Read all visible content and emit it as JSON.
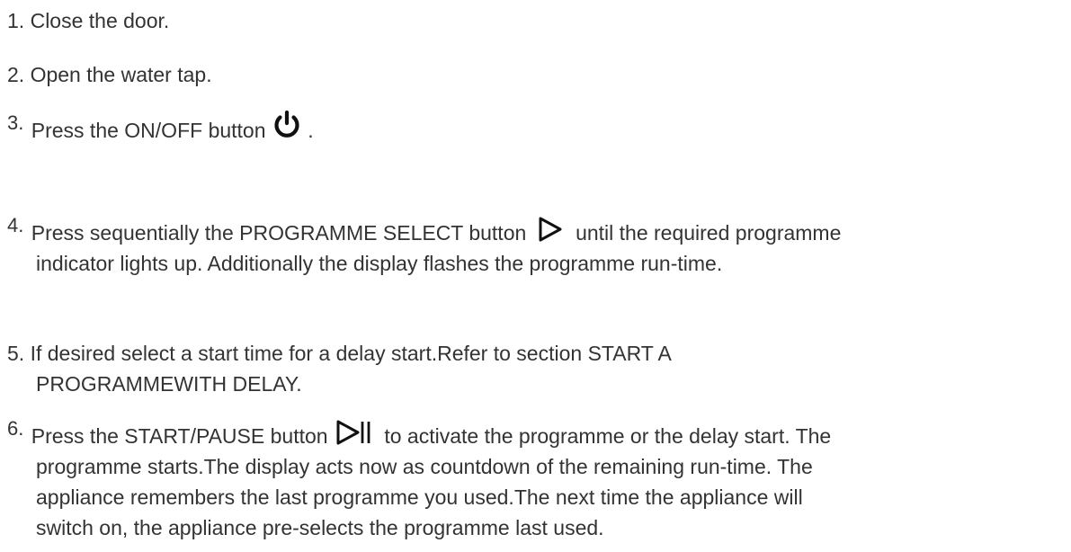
{
  "steps": [
    {
      "number": "1.",
      "text": "Close the door."
    },
    {
      "number": "2.",
      "text": "Open the water tap."
    },
    {
      "number": "3.",
      "before": "Press the ON/OFF button",
      "icon": "power-icon",
      "after": "."
    },
    {
      "number": "4.",
      "before": "Press sequentially the PROGRAMME SELECT button",
      "icon": "play-outline-icon",
      "after": "until the required programme",
      "line2": "indicator lights up. Additionally the display flashes the programme run-time."
    },
    {
      "number": "5.",
      "text": "If desired select a start time for a delay start.Refer to section START A",
      "line2": "PROGRAMMEWITH DELAY."
    },
    {
      "number": "6.",
      "before": "Press the START/PAUSE button",
      "icon": "play-pause-icon",
      "after": "to activate the programme or the delay start. The",
      "line2": "programme starts.The display acts now as countdown of the remaining run-time. The",
      "line3": "appliance remembers the last programme you used.The next time the appliance will",
      "line4": "switch on, the appliance pre-selects the programme last used."
    }
  ]
}
